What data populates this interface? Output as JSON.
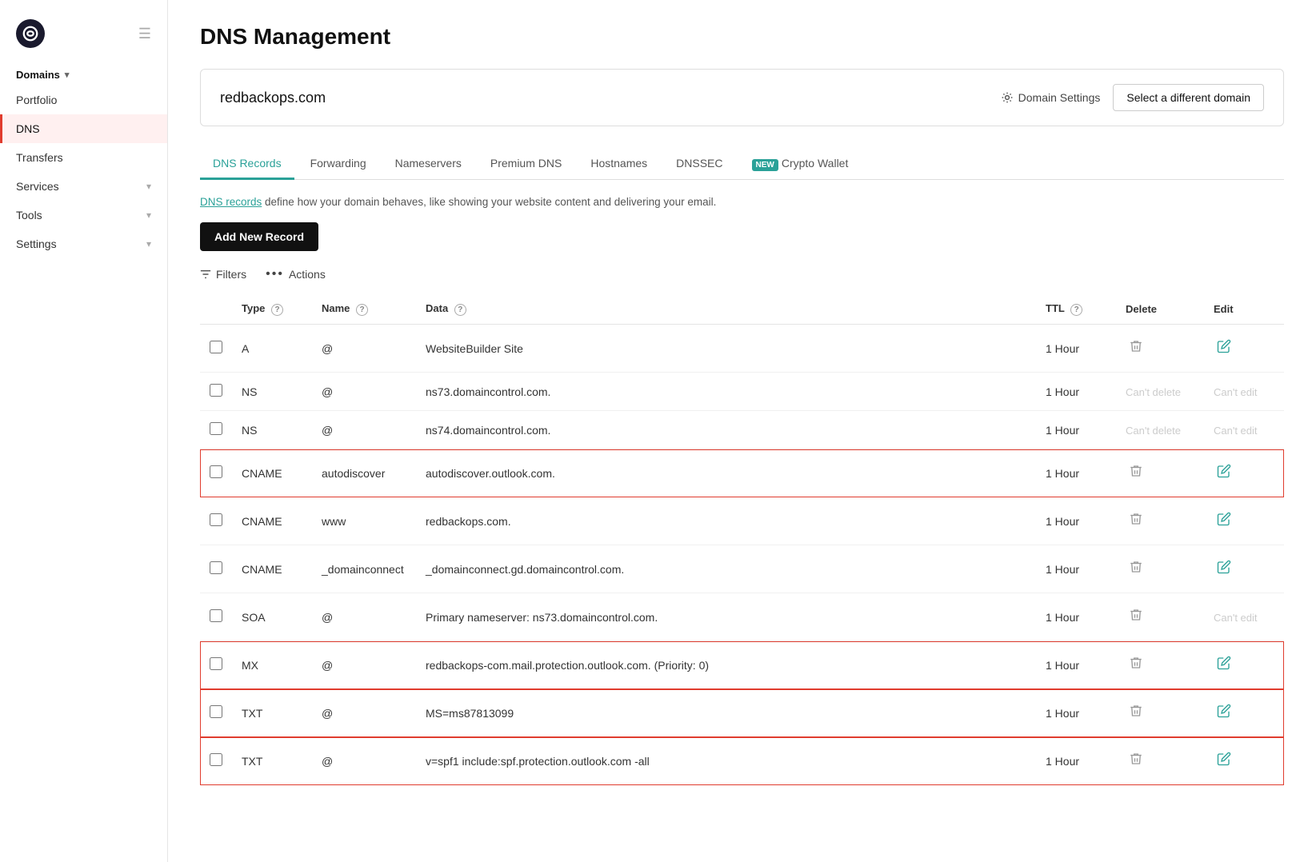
{
  "sidebar": {
    "logo_text": "G",
    "domains_label": "Domains",
    "portfolio_label": "Portfolio",
    "dns_label": "DNS",
    "transfers_label": "Transfers",
    "services_label": "Services",
    "tools_label": "Tools",
    "settings_label": "Settings"
  },
  "header": {
    "title": "DNS Management"
  },
  "domain_bar": {
    "domain_name": "redbackops.com",
    "settings_label": "Domain Settings",
    "select_domain_label": "Select a different domain"
  },
  "tabs": [
    {
      "label": "DNS Records",
      "active": true,
      "new": false
    },
    {
      "label": "Forwarding",
      "active": false,
      "new": false
    },
    {
      "label": "Nameservers",
      "active": false,
      "new": false
    },
    {
      "label": "Premium DNS",
      "active": false,
      "new": false
    },
    {
      "label": "Hostnames",
      "active": false,
      "new": false
    },
    {
      "label": "DNSSEC",
      "active": false,
      "new": false
    },
    {
      "label": "Crypto Wallet",
      "active": false,
      "new": true
    }
  ],
  "dns_description": {
    "link_text": "DNS records",
    "rest_text": " define how your domain behaves, like showing your website content and delivering your email."
  },
  "toolbar": {
    "add_record_label": "Add New Record",
    "filters_label": "Filters",
    "actions_label": "Actions"
  },
  "table": {
    "columns": [
      "",
      "Type",
      "Name",
      "Data",
      "TTL",
      "Delete",
      "Edit"
    ],
    "rows": [
      {
        "type": "A",
        "name": "@",
        "data": "WebsiteBuilder Site",
        "ttl": "1 Hour",
        "can_delete": true,
        "can_edit": true,
        "highlighted": false
      },
      {
        "type": "NS",
        "name": "@",
        "data": "ns73.domaincontrol.com.",
        "ttl": "1 Hour",
        "can_delete": false,
        "can_edit": false,
        "highlighted": false
      },
      {
        "type": "NS",
        "name": "@",
        "data": "ns74.domaincontrol.com.",
        "ttl": "1 Hour",
        "can_delete": false,
        "can_edit": false,
        "highlighted": false
      },
      {
        "type": "CNAME",
        "name": "autodiscover",
        "data": "autodiscover.outlook.com.",
        "ttl": "1 Hour",
        "can_delete": true,
        "can_edit": true,
        "highlighted": true
      },
      {
        "type": "CNAME",
        "name": "www",
        "data": "redbackops.com.",
        "ttl": "1 Hour",
        "can_delete": true,
        "can_edit": true,
        "highlighted": false
      },
      {
        "type": "CNAME",
        "name": "_domainconnect",
        "data": "_domainconnect.gd.domaincontrol.com.",
        "ttl": "1 Hour",
        "can_delete": true,
        "can_edit": true,
        "highlighted": false
      },
      {
        "type": "SOA",
        "name": "@",
        "data": "Primary nameserver: ns73.domaincontrol.com.",
        "ttl": "1 Hour",
        "can_delete": true,
        "can_edit": false,
        "highlighted": false
      },
      {
        "type": "MX",
        "name": "@",
        "data": "redbackops-com.mail.protection.outlook.com. (Priority: 0)",
        "ttl": "1 Hour",
        "can_delete": true,
        "can_edit": true,
        "highlighted": true
      },
      {
        "type": "TXT",
        "name": "@",
        "data": "MS=ms87813099",
        "ttl": "1 Hour",
        "can_delete": true,
        "can_edit": true,
        "highlighted": true
      },
      {
        "type": "TXT",
        "name": "@",
        "data": "v=spf1 include:spf.protection.outlook.com -all",
        "ttl": "1 Hour",
        "can_delete": true,
        "can_edit": true,
        "highlighted": true
      }
    ],
    "cant_delete_text": "Can't delete",
    "cant_edit_text": "Can't edit"
  }
}
